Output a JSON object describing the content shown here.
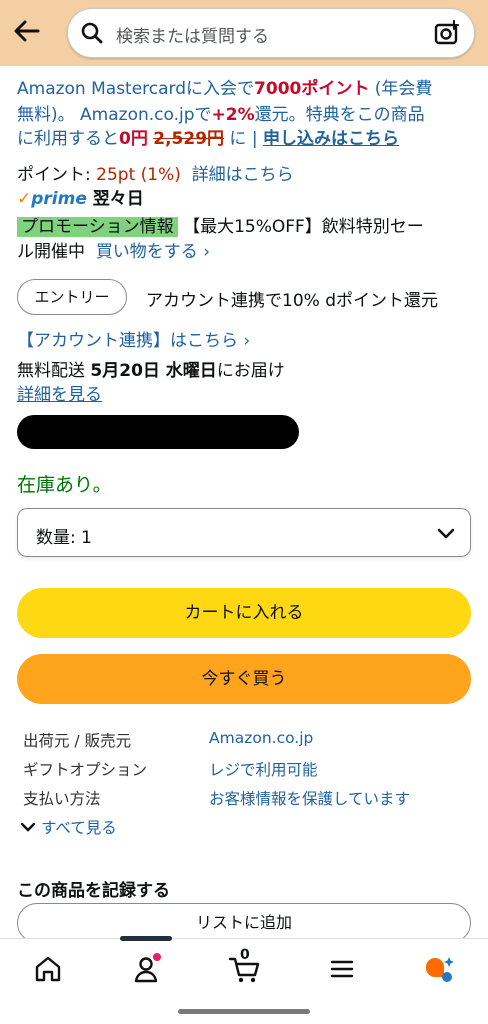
{
  "header": {
    "search_placeholder": "検索または質問する",
    "icons": {
      "back": "back-arrow-icon",
      "search": "search-icon",
      "camera": "camera-icon"
    }
  },
  "promo": {
    "l1_a": "Amazon Mastercardに入会で",
    "l1_points": "7000ポイント",
    "l1_b": " (年会費",
    "l2_a": "無料)。 Amazon.co.jpで",
    "l2_pct": "+2%",
    "l2_b": "還元。特典をこの商品",
    "l3_a": "に利用すると",
    "l3_zero": "0円",
    "l3_strike": "2,529円",
    "l3_b": " に | ",
    "l3_link": "申し込みはこちら"
  },
  "points": {
    "label": "ポイント: ",
    "value": "25pt (1%)",
    "link": "詳細はこちら"
  },
  "prime": {
    "mark": "prime",
    "delivery": "翌々日"
  },
  "promotion": {
    "badge": "プロモーション情報",
    "text": "【最大15%OFF】飲料特別セー",
    "text2": "ル開催中",
    "link": "買い物をする ›"
  },
  "entry": {
    "button": "エントリー",
    "text": "アカウント連携で10% dポイント還元",
    "link": "【アカウント連携】はこちら ›"
  },
  "shipping": {
    "prefix": "無料配送 ",
    "date": "5月20日 水曜日",
    "suffix": "にお届け",
    "details_link": "詳細を見る"
  },
  "stock": "在庫あり。",
  "quantity": {
    "label": "数量: 1"
  },
  "buttons": {
    "add_to_cart": "カートに入れる",
    "buy_now": "今すぐ買う"
  },
  "info": [
    {
      "label": "出荷元 / 販売元",
      "value": "Amazon.co.jp"
    },
    {
      "label": "ギフトオプション",
      "value": "レジで利用可能"
    },
    {
      "label": "支払い方法",
      "value": "お客様情報を保護しています"
    }
  ],
  "see_all": "すべて見る",
  "record": {
    "title": "この商品を記録する",
    "list_button": "リストに追加"
  },
  "nav": {
    "cart_count": "0",
    "accent": "#ff6a00"
  },
  "colors": {
    "header_bg": "#f4cfa3",
    "cart_btn": "#ffd814",
    "buy_btn": "#ffa41c",
    "link": "#2162a1",
    "stock": "#007600"
  }
}
